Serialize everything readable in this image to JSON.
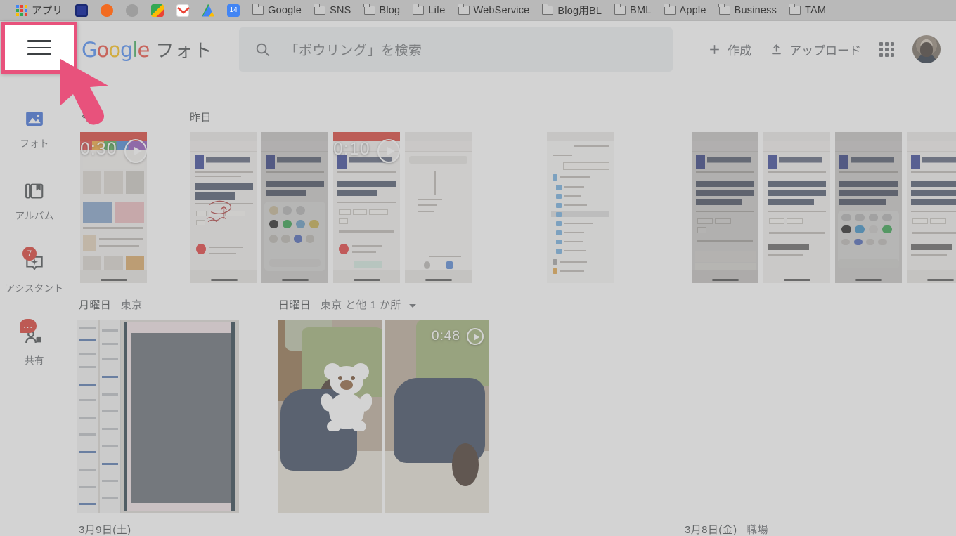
{
  "browser": {
    "bookmarks": [
      {
        "label": "アプリ",
        "icon": "apps-grid-icon"
      },
      {
        "label": "",
        "icon": "blue-doc-icon"
      },
      {
        "label": "",
        "icon": "orange-circle-icon"
      },
      {
        "label": "",
        "icon": "grey-circle-icon"
      },
      {
        "label": "",
        "icon": "google-maps-icon"
      },
      {
        "label": "",
        "icon": "gmail-icon"
      },
      {
        "label": "",
        "icon": "google-drive-icon"
      },
      {
        "label": "",
        "icon": "calendar-14-icon"
      },
      {
        "label": "Google",
        "icon": "folder-icon"
      },
      {
        "label": "SNS",
        "icon": "folder-icon"
      },
      {
        "label": "Blog",
        "icon": "folder-icon"
      },
      {
        "label": "Life",
        "icon": "folder-icon"
      },
      {
        "label": "WebService",
        "icon": "folder-icon"
      },
      {
        "label": "Blog用BL",
        "icon": "folder-icon"
      },
      {
        "label": "BML",
        "icon": "folder-icon"
      },
      {
        "label": "Apple",
        "icon": "folder-icon"
      },
      {
        "label": "Business",
        "icon": "folder-icon"
      },
      {
        "label": "TAM",
        "icon": "folder-icon"
      }
    ]
  },
  "header": {
    "menu_icon": "hamburger-menu-icon",
    "logo_google": "Google",
    "logo_product": "フォト",
    "search": {
      "placeholder": "「ボウリング」を検索",
      "icon": "search-icon"
    },
    "create_label": "作成",
    "upload_label": "アップロード",
    "apps_label": "apps-grid-icon",
    "avatar_label": "avatar"
  },
  "sidebar": {
    "items": [
      {
        "label": "フォト",
        "icon": "photo-icon",
        "active": true,
        "badge": ""
      },
      {
        "label": "アルバム",
        "icon": "album-icon",
        "active": false,
        "badge": ""
      },
      {
        "label": "アシスタント",
        "icon": "assistant-icon",
        "active": false,
        "badge": "7"
      },
      {
        "label": "共有",
        "icon": "shared-icon",
        "active": false,
        "badge": "..."
      }
    ]
  },
  "content": {
    "sections": [
      {
        "title": "今日",
        "place": "",
        "caret": false
      },
      {
        "title": "昨日",
        "place": "",
        "caret": false
      },
      {
        "title": "月曜日",
        "place": "東京",
        "caret": false
      },
      {
        "title": "日曜日",
        "place": "東京 と他 1 か所",
        "caret": true
      },
      {
        "title": "3月9日(土)",
        "place": "",
        "caret": false
      },
      {
        "title": "3月8日(金)",
        "place": "職場",
        "caret": false
      }
    ],
    "media": {
      "video_durations": [
        "0:30",
        "0:10",
        "0:48"
      ],
      "row1_count": 9,
      "row2_count": 3
    }
  },
  "annotation": {
    "highlight_target": "hamburger-menu-icon",
    "highlight_color": "#e8527c",
    "cursor_color": "#e8527c"
  }
}
